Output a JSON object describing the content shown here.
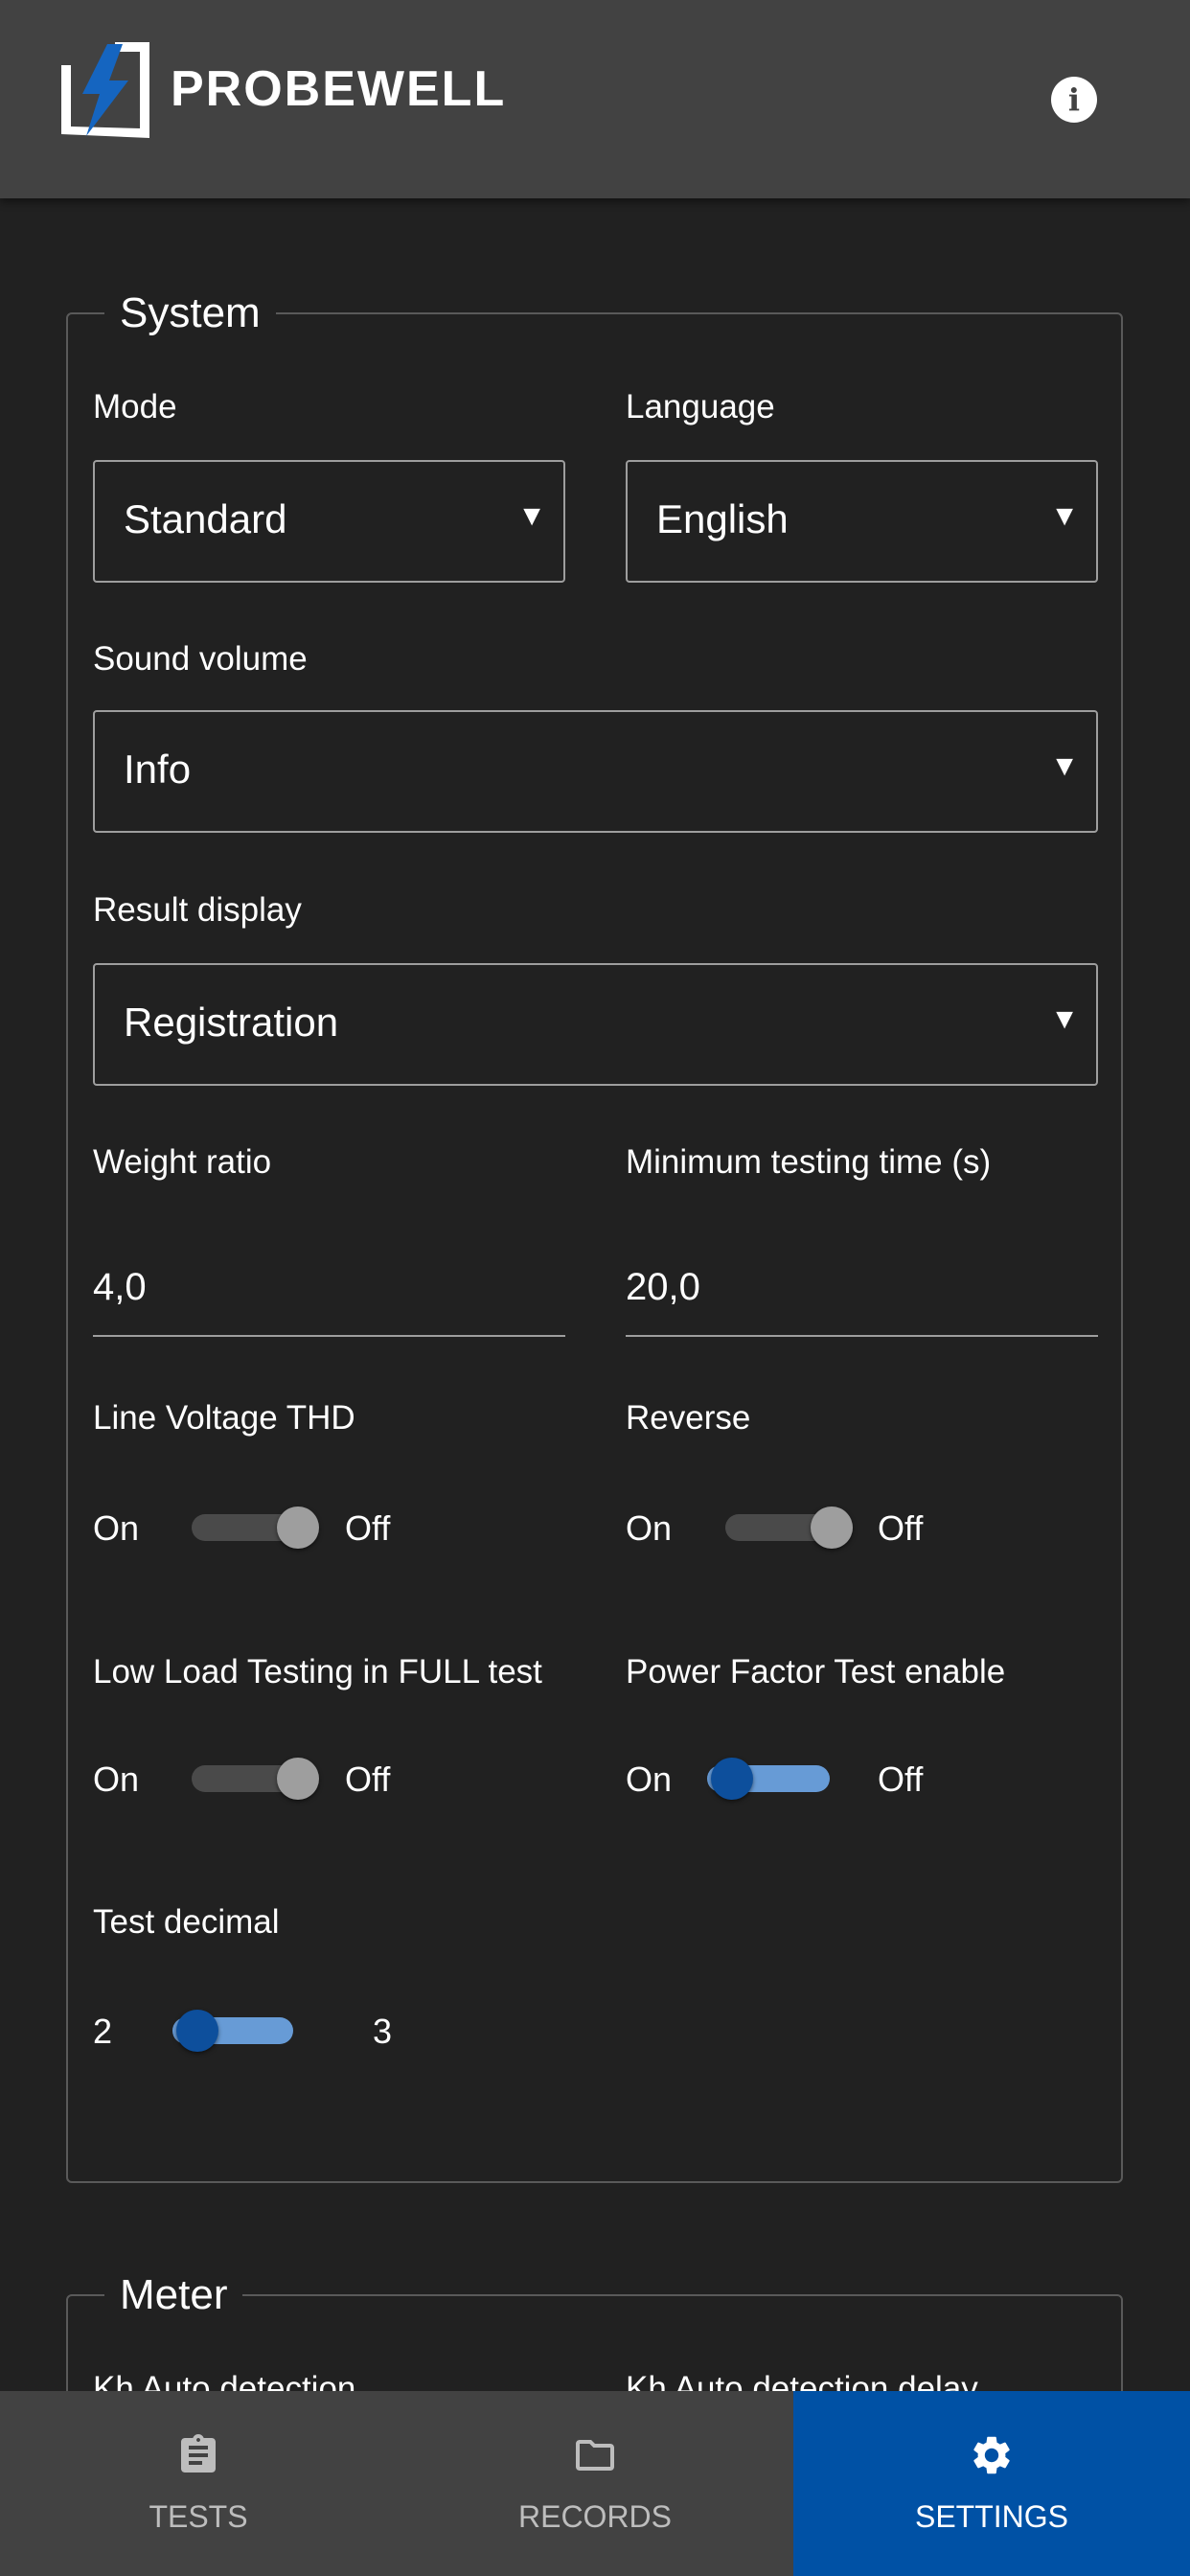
{
  "header": {
    "brand": "PROBEWELL",
    "info_icon": "info-icon"
  },
  "colors": {
    "accent": "#0051a5",
    "background": "#212121",
    "header": "#424242",
    "switch_on": "#679bd6"
  },
  "system": {
    "title": "System",
    "mode": {
      "label": "Mode",
      "value": "Standard"
    },
    "language": {
      "label": "Language",
      "value": "English"
    },
    "sound_volume": {
      "label": "Sound volume",
      "value": "Info"
    },
    "result_display": {
      "label": "Result display",
      "value": "Registration"
    },
    "weight_ratio": {
      "label": "Weight ratio",
      "value": "4,0"
    },
    "min_testing_time": {
      "label": "Minimum testing time (s)",
      "value": "20,0"
    },
    "line_voltage_thd": {
      "label": "Line Voltage THD",
      "on": "On",
      "off": "Off",
      "state": "Off"
    },
    "reverse": {
      "label": "Reverse",
      "on": "On",
      "off": "Off",
      "state": "Off"
    },
    "low_load": {
      "label": "Low Load Testing in FULL test",
      "on": "On",
      "off": "Off",
      "state": "Off"
    },
    "power_factor": {
      "label": "Power Factor Test enable",
      "on": "On",
      "off": "Off",
      "state": "On"
    },
    "test_decimal": {
      "label": "Test decimal",
      "left": "2",
      "right": "3",
      "state": "2"
    }
  },
  "meter": {
    "title": "Meter",
    "kh_auto_detection": {
      "label": "Kh Auto detection"
    },
    "kh_auto_detection_delay": {
      "label": "Kh Auto detection delay"
    }
  },
  "nav": {
    "tests": {
      "label": "TESTS",
      "icon": "clipboard-icon"
    },
    "records": {
      "label": "RECORDS",
      "icon": "folder-icon"
    },
    "settings": {
      "label": "SETTINGS",
      "icon": "gear-icon",
      "active": true
    }
  }
}
